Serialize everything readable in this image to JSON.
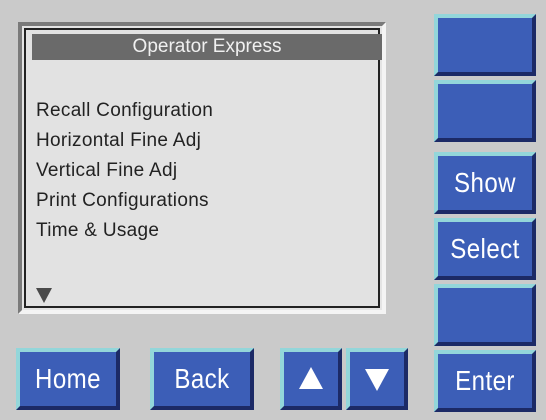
{
  "screen": {
    "title": "Operator Express",
    "menu_items": [
      "Recall Configuration",
      "Horizontal Fine Adj",
      "Vertical Fine Adj",
      "Print Configurations",
      "Time & Usage"
    ],
    "scroll_indicator": "down-triangle-icon"
  },
  "side_buttons": {
    "button_1_label": "",
    "button_2_label": "",
    "show_label": "Show",
    "select_label": "Select",
    "button_5_label": "",
    "enter_label": "Enter"
  },
  "bottom_buttons": {
    "home_label": "Home",
    "back_label": "Back",
    "up_icon": "up-arrow-icon",
    "down_icon": "down-arrow-icon"
  },
  "colors": {
    "button_blue": "#3c5eb7",
    "button_highlight": "#93d6da",
    "panel_gray": "#cacaca",
    "title_bar": "#6a6a6a"
  }
}
